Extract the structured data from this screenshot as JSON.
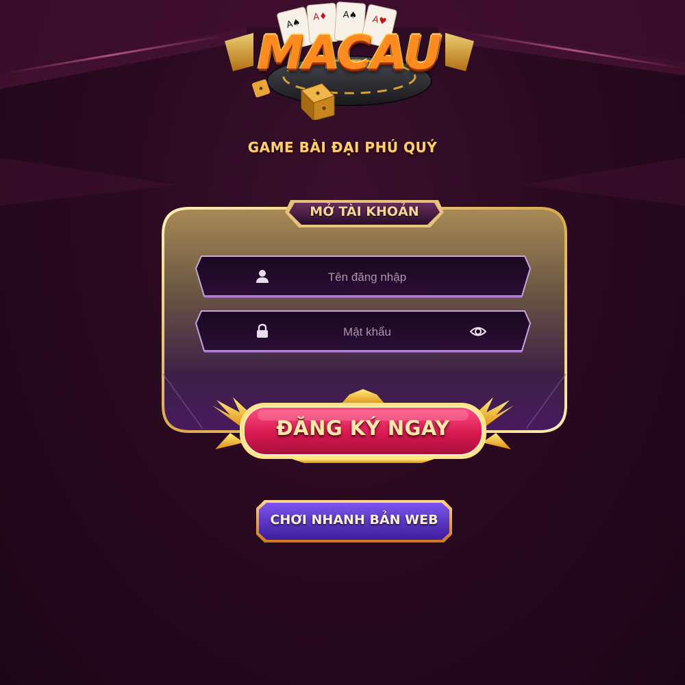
{
  "brand": {
    "logo_text": "MACAU",
    "tagline": "GAME BÀI ĐẠI PHÚ QUÝ"
  },
  "panel": {
    "title": "MỞ TÀI KHOẢN"
  },
  "form": {
    "username": {
      "value": "",
      "placeholder": "Tên đăng nhập",
      "icon": "user-icon"
    },
    "password": {
      "value": "",
      "placeholder": "Mật khẩu",
      "icon": "lock-icon",
      "toggle_icon": "eye-icon"
    }
  },
  "buttons": {
    "register_label": "ĐĂNG KÝ NGAY",
    "web_play_label": "CHƠI NHANH BẢN WEB"
  },
  "colors": {
    "background": "#2a0a20",
    "gold": "#ffcf6b",
    "register_button": "#e0225a",
    "web_button": "#5a2fc4"
  }
}
